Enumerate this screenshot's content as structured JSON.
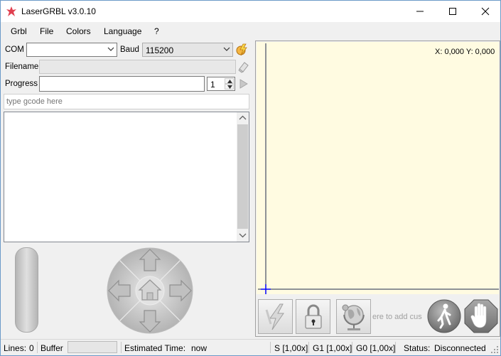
{
  "window": {
    "title": "LaserGRBL v3.0.10",
    "minimize_icon": "minimize-icon",
    "maximize_icon": "maximize-icon",
    "close_icon": "close-icon"
  },
  "menu": [
    "Grbl",
    "File",
    "Colors",
    "Language",
    "?"
  ],
  "connection": {
    "com_label": "COM",
    "com_value": "",
    "baud_label": "Baud",
    "baud_value": "115200"
  },
  "file": {
    "filename_label": "Filename",
    "filename_value": "",
    "progress_label": "Progress",
    "progress_fraction": 0,
    "copies_value": "1"
  },
  "console": {
    "gcode_placeholder": "type gcode here",
    "log": ""
  },
  "preview": {
    "coords": "X: 0,000 Y: 0,000"
  },
  "custom_buttons": {
    "add_custom_hint": "ere to add cus"
  },
  "status": {
    "lines_label": "Lines:",
    "lines_value": "0",
    "buffer_label": "Buffer",
    "buffer_fraction": 0,
    "est_label": "Estimated Time:",
    "est_value": "now",
    "s_override": "S [1,00x]",
    "g1_override": "G1 [1,00x]",
    "g0_override": "G0 [1,00x]",
    "status_label": "Status:",
    "status_value": "Disconnected"
  },
  "colors": {
    "canvas_bg": "#fffbe1",
    "origin_marker": "#0000ff",
    "accent": "#e04050"
  }
}
